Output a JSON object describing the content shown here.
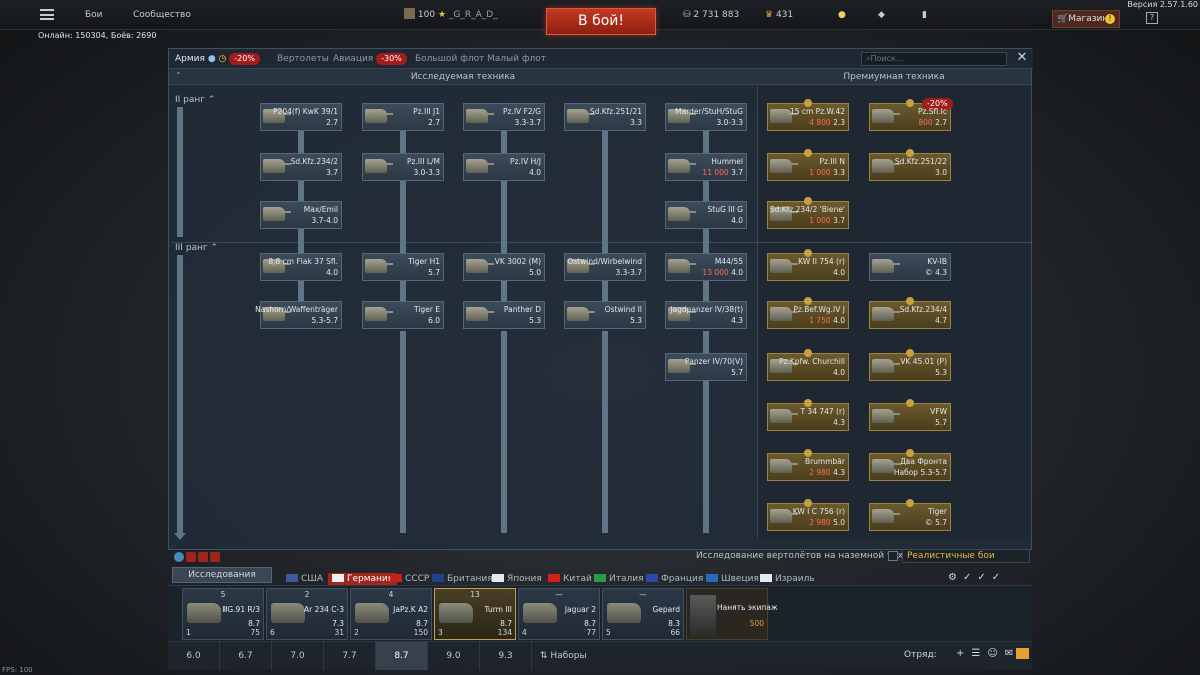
{
  "topbar": {
    "menu_items": [
      "Бои",
      "Сообщество"
    ],
    "player_level": "100",
    "player_name": "_G_R_A_D_",
    "battle_button": "В бой!",
    "silver_lions": "2 731 883",
    "golden_eagles": "431",
    "shop_label": "Магазин",
    "shop_badge": "!",
    "help": "?",
    "version": "Версия 2.57.1.60",
    "online": "Онлайн: 150304, Боёв: 2690"
  },
  "tabs": [
    {
      "label": "Армия",
      "active": true,
      "discount": "-20%"
    },
    {
      "label": "Вертолеты",
      "active": false
    },
    {
      "label": "Авиация",
      "active": false,
      "discount": "-30%"
    },
    {
      "label": "Большой флот",
      "active": false
    },
    {
      "label": "Малый флот",
      "active": false
    }
  ],
  "search": {
    "placeholder": "Поиск..."
  },
  "headers": {
    "researched": "Исследуемая техника",
    "premium": "Премиумная техника"
  },
  "ranks": [
    "II ранг",
    "III ранг"
  ],
  "tree": [
    {
      "name": "P204(f) KwK 39/1",
      "br": "2.7",
      "cost": ""
    },
    {
      "name": "Sd.Kfz.234/2",
      "br": "3.7",
      "cost": ""
    },
    {
      "name": "Max/Emil",
      "br": "3.7-4.0",
      "cost": ""
    },
    {
      "name": "8,8 cm Flak 37 Sfl.",
      "br": "4.0",
      "cost": ""
    },
    {
      "name": "Nashorn/Waffenträger",
      "br": "5.3-5.7",
      "cost": ""
    },
    {
      "name": "Pz.III J1",
      "br": "2.7",
      "cost": ""
    },
    {
      "name": "Pz.III L/M",
      "br": "3.0-3.3",
      "cost": ""
    },
    {
      "name": "Tiger H1",
      "br": "5.7",
      "cost": ""
    },
    {
      "name": "Tiger E",
      "br": "6.0",
      "cost": ""
    },
    {
      "name": "Pz.IV F2/G",
      "br": "3.3-3.7",
      "cost": ""
    },
    {
      "name": "Pz.IV H/J",
      "br": "4.0",
      "cost": ""
    },
    {
      "name": "VK 3002 (M)",
      "br": "5.0",
      "cost": ""
    },
    {
      "name": "Panther D",
      "br": "5.3",
      "cost": ""
    },
    {
      "name": "Sd.Kfz.251/21",
      "br": "3.3",
      "cost": ""
    },
    {
      "name": "Ostwind/Wirbelwind",
      "br": "3.3-3.7",
      "cost": ""
    },
    {
      "name": "Ostwind II",
      "br": "5.3",
      "cost": ""
    },
    {
      "name": "Marder/StuH/StuG",
      "br": "3.0-3.3",
      "cost": ""
    },
    {
      "name": "Hummel",
      "br": "3.7",
      "cost": "11 000"
    },
    {
      "name": "StuG III G",
      "br": "4.0",
      "cost": ""
    },
    {
      "name": "M44/55",
      "br": "4.0",
      "cost": "13 000"
    },
    {
      "name": "Jagdpanzer IV/38(t)",
      "br": "4.3",
      "cost": ""
    },
    {
      "name": "Panzer IV/70(V)",
      "br": "5.7",
      "cost": ""
    }
  ],
  "premium": [
    {
      "name": "15 cm Pz.W.42",
      "br": "2.3",
      "cost": "4 800"
    },
    {
      "name": "Pz.Sfl.Ic",
      "br": "2.7",
      "cost": "800",
      "discount": "-20%"
    },
    {
      "name": "Pz.III N",
      "br": "3.3",
      "cost": "1 000"
    },
    {
      "name": "Sd.Kfz.251/22",
      "br": "3.0",
      "cost": ""
    },
    {
      "name": "Sd.Kfz.234/2 'Biene'",
      "br": "3.7",
      "cost": "1 000"
    },
    {
      "name": "KW II 754 (r)",
      "br": "4.0",
      "cost": ""
    },
    {
      "name": "KV-IB",
      "br": "4.3",
      "cost": ""
    },
    {
      "name": "Pz.Bef.Wg.IV J",
      "br": "4.0",
      "cost": "1 750"
    },
    {
      "name": "Sd.Kfz.234/4",
      "br": "4.7",
      "cost": ""
    },
    {
      "name": "Pz.Kpfw. Churchill",
      "br": "4.0",
      "cost": ""
    },
    {
      "name": "VK 45.01 (P)",
      "br": "5.3",
      "cost": ""
    },
    {
      "name": "T 34 747 (r)",
      "br": "4.3",
      "cost": ""
    },
    {
      "name": "VFW",
      "br": "5.7",
      "cost": ""
    },
    {
      "name": "Brummbär",
      "br": "4.3",
      "cost": "2 980"
    },
    {
      "name": "Два Фронта",
      "br": "5.3-5.7",
      "cost": "",
      "prefix": "Набор"
    },
    {
      "name": "KW I C 756 (r)",
      "br": "5.0",
      "cost": "2 980"
    },
    {
      "name": "Tiger",
      "br": "5.7",
      "cost": ""
    }
  ],
  "bottom": {
    "heli_research": "Исследование вертолётов на наземной технике",
    "mode": "Реалистичные бои",
    "research_button": "Исследования"
  },
  "nations": [
    {
      "name": "США",
      "color": "#3c5a9a",
      "active": false
    },
    {
      "name": "Германия",
      "color": "#c02c20",
      "active": true
    },
    {
      "name": "СССР",
      "color": "#c8201c",
      "active": false
    },
    {
      "name": "Британия",
      "color": "#23408c",
      "active": false
    },
    {
      "name": "Япония",
      "color": "#e8e8e8",
      "active": false
    },
    {
      "name": "Китай",
      "color": "#d02018",
      "active": false
    },
    {
      "name": "Италия",
      "color": "#2a9a48",
      "active": false
    },
    {
      "name": "Франция",
      "color": "#2a4aa8",
      "active": false
    },
    {
      "name": "Швеция",
      "color": "#2a6ab8",
      "active": false
    },
    {
      "name": "Израиль",
      "color": "#e8e8f0",
      "active": false
    }
  ],
  "slots": [
    {
      "br_top": "5",
      "name": "ⅢG.91 R/3",
      "br": "8.7",
      "left": "1",
      "right": "75"
    },
    {
      "br_top": "2",
      "name": "Ar 234 C-3",
      "br": "7.3",
      "left": "6",
      "right": "31"
    },
    {
      "br_top": "4",
      "name": "JaPz.K A2",
      "br": "8.7",
      "left": "2",
      "right": "150"
    },
    {
      "br_top": "13",
      "name": "Turm III",
      "br": "8.7",
      "left": "3",
      "right": "134"
    },
    {
      "br_top": "—",
      "name": "Jaguar 2",
      "br": "8.7",
      "left": "4",
      "right": "77"
    },
    {
      "br_top": "—",
      "name": "Gepard",
      "br": "8.3",
      "left": "5",
      "right": "66"
    }
  ],
  "crew": {
    "label": "Нанять экипаж",
    "cost": "500"
  },
  "br_tabs": [
    "6.0",
    "6.7",
    "7.0",
    "7.7",
    "8.7",
    "9.0",
    "9.3"
  ],
  "sets_label": "Наборы",
  "squad_label": "Отряд:",
  "fps": "FPS: 100"
}
